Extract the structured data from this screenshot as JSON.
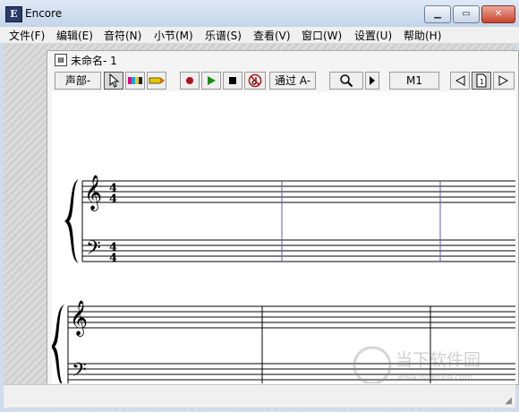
{
  "app": {
    "title": "Encore",
    "icon_letter": "E"
  },
  "window_controls": {
    "minimize": "minimize-icon",
    "maximize": "maximize-icon",
    "close": "close-icon"
  },
  "menu": [
    {
      "label": "文件(F)"
    },
    {
      "label": "编辑(E)"
    },
    {
      "label": "音符(N)"
    },
    {
      "label": "小节(M)"
    },
    {
      "label": "乐谱(S)"
    },
    {
      "label": "查看(V)"
    },
    {
      "label": "窗口(W)"
    },
    {
      "label": "设置(U)"
    },
    {
      "label": "帮助(H)"
    }
  ],
  "document": {
    "title": "未命名- 1"
  },
  "toolbar": {
    "voice_label": "声部-",
    "pass_label": "通过 A-",
    "measure_label": "M1",
    "icons": [
      "arrow-pointer-icon",
      "color-bars-icon",
      "pencil-icon",
      "record-icon",
      "play-icon",
      "stop-icon",
      "no-sound-icon",
      "magnifier-icon",
      "play-arrow-icon",
      "prev-page-icon",
      "page-icon",
      "next-page-icon"
    ]
  },
  "score": {
    "time_signature": {
      "top": "4",
      "bottom": "4"
    },
    "systems": 2,
    "staves_per_system": 2,
    "clefs": [
      "treble",
      "bass"
    ]
  },
  "watermark": {
    "brand": "当下软件园",
    "url": "www.downxia.com"
  },
  "colors": {
    "barline": "#5b5fa8",
    "record": "#b0101c",
    "play": "#1a8a1a",
    "staff": "#000000"
  }
}
